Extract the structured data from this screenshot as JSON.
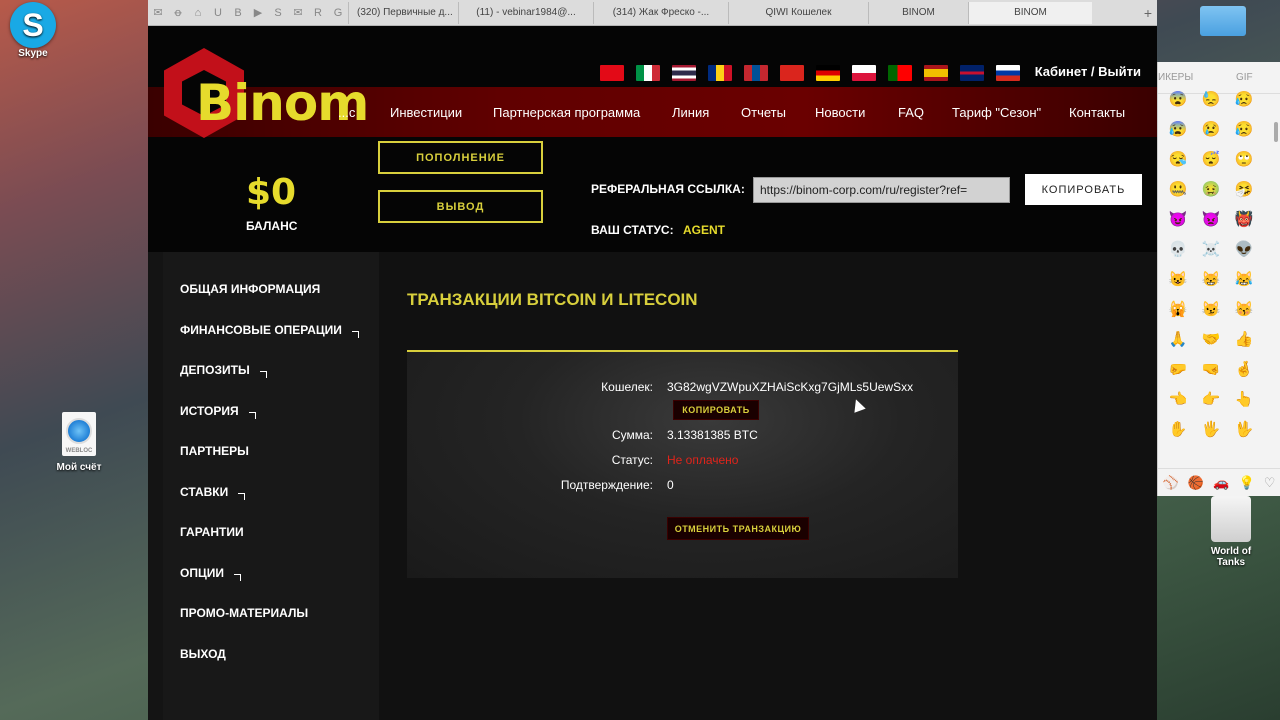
{
  "desktop": {
    "skype_label": "Skype",
    "webloc_label": "Мой счёт",
    "webloc_tag": "WEBLOC",
    "wot_label": "World of Tanks"
  },
  "browser": {
    "tabs": [
      {
        "label": "(320) Первичные д..."
      },
      {
        "label": "(11) - vebinar1984@..."
      },
      {
        "label": "(314) Жак Фреско -..."
      },
      {
        "label": "QIWI Кошелек"
      },
      {
        "label": "BINOM"
      },
      {
        "label": "BINOM"
      }
    ],
    "new_tab": "+"
  },
  "site": {
    "logo": "Binom",
    "cabinet": "Кабинет / Выйти",
    "nav": [
      "...с",
      "Инвестиции",
      "Партнерская программа",
      "Линия",
      "Отчеты",
      "Новости",
      "FAQ",
      "Тариф \"Сезон\"",
      "Контакты"
    ],
    "balance_amount": "$0",
    "balance_label": "БАЛАНС",
    "deposit_button": "ПОПОЛНЕНИЕ",
    "withdraw_button": "ВЫВОД",
    "ref_label": "РЕФЕРАЛЬНАЯ ССЫЛКА:",
    "ref_value": "https://binom-corp.com/ru/register?ref=",
    "copy_button": "КОПИРОВАТЬ",
    "status_label": "ВАШ СТАТУС:",
    "status_value": "AGENT",
    "colors": {
      "accent": "#e6db2c",
      "red": "#c2101a",
      "dark": "#050505",
      "unpaid": "#e0241b"
    }
  },
  "sidebar": {
    "items": [
      {
        "label": "ОБЩАЯ ИНФОРМАЦИЯ",
        "chevron": false
      },
      {
        "label": "ФИНАНСОВЫЕ ОПЕРАЦИИ",
        "chevron": true
      },
      {
        "label": "ДЕПОЗИТЫ",
        "chevron": true
      },
      {
        "label": "ИСТОРИЯ",
        "chevron": true
      },
      {
        "label": "ПАРТНЕРЫ",
        "chevron": false
      },
      {
        "label": "СТАВКИ",
        "chevron": true
      },
      {
        "label": "ГАРАНТИИ",
        "chevron": false
      },
      {
        "label": "ОПЦИИ",
        "chevron": true
      },
      {
        "label": "ПРОМО-МАТЕРИАЛЫ",
        "chevron": false
      },
      {
        "label": "ВЫХОД",
        "chevron": false
      }
    ]
  },
  "transaction": {
    "title": "ТРАНЗАКЦИИ BITCOIN И LITECOIN",
    "wallet_label": "Кошелек:",
    "wallet_value": "3G82wgVZWpuXZHAiScKxg7GjMLs5UewSxx",
    "copy_button": "КОПИРОВАТЬ",
    "sum_label": "Сумма:",
    "sum_value": "3.13381385 BTC",
    "status_label": "Статус:",
    "status_value": "Не оплачено",
    "confirm_label": "Подтверждение:",
    "confirm_value": "0",
    "cancel_button": "ОТМЕНИТЬ ТРАНЗАКЦИЮ"
  },
  "emoji_panel": {
    "tab_stickers": "ИКЕРЫ",
    "tab_gif": "GIF",
    "emojis": [
      "😨",
      "😓",
      "😥",
      "😰",
      "😢",
      "😥",
      "😪",
      "😴",
      "🙄",
      "🤐",
      "🤢",
      "🤧",
      "😈",
      "👿",
      "👹",
      "💀",
      "☠️",
      "👽",
      "😺",
      "😸",
      "😹",
      "🙀",
      "😼",
      "😽",
      "🙏",
      "🤝",
      "👍",
      "🤛",
      "🤜",
      "🤞",
      "👈",
      "👉",
      "👆",
      "✋",
      "🖐️",
      "🖖"
    ],
    "footer_icons": [
      "⚾",
      "🏀",
      "🚗",
      "💡",
      "♡"
    ]
  }
}
